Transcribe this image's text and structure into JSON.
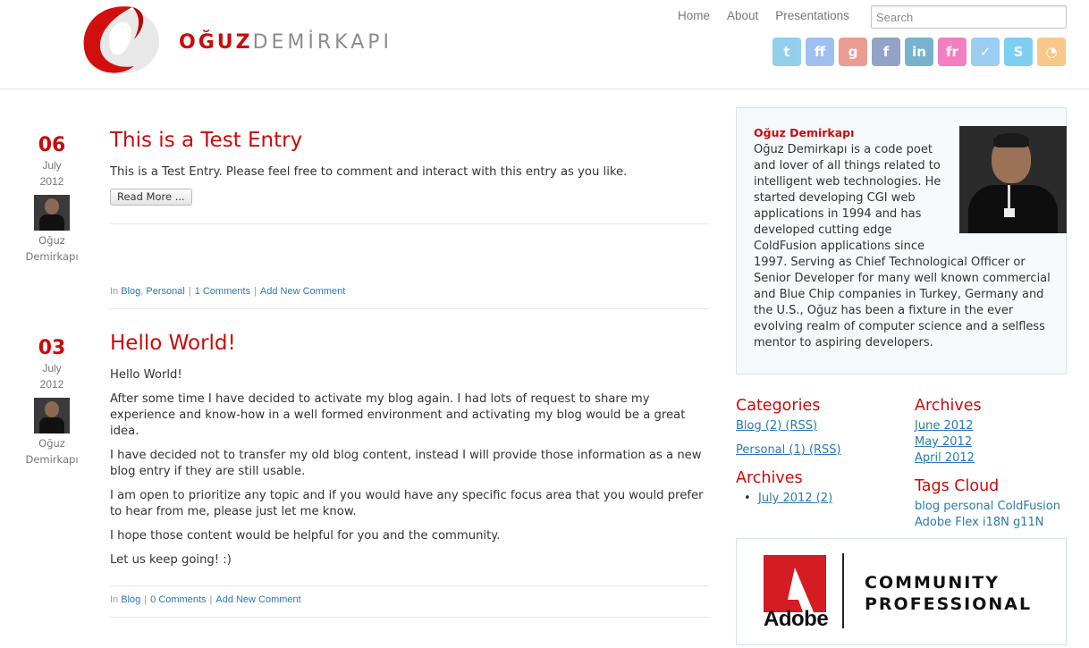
{
  "header": {
    "logo_first": "OĞUZ",
    "logo_last": "DEMİRKAPI",
    "nav": [
      "Home",
      "About",
      "Presentations"
    ],
    "search_placeholder": "Search",
    "social": [
      {
        "icon": "twitter-icon",
        "glyph": "t",
        "color": "#38a9e0"
      },
      {
        "icon": "friendfeed-icon",
        "glyph": "ff",
        "color": "#4f8ee6"
      },
      {
        "icon": "google-icon",
        "glyph": "g",
        "color": "#dd4b39"
      },
      {
        "icon": "facebook-icon",
        "glyph": "f",
        "color": "#3b5998"
      },
      {
        "icon": "linkedin-icon",
        "glyph": "in",
        "color": "#0c73a8"
      },
      {
        "icon": "friendster-icon",
        "glyph": "fr",
        "color": "#e8188d"
      },
      {
        "icon": "foursquare-icon",
        "glyph": "✓",
        "color": "#4aa7e4"
      },
      {
        "icon": "skype-icon",
        "glyph": "S",
        "color": "#13a9e6"
      },
      {
        "icon": "rss-icon",
        "glyph": "◔",
        "color": "#f39a2c"
      }
    ]
  },
  "posts": [
    {
      "day": "06",
      "month": "July",
      "year": "2012",
      "author_first": "Oğuz",
      "author_last": "Demirkapı",
      "title": "This is a Test Entry",
      "body": [
        "This is a Test Entry. Please feel free to comment and interact with this entry as you like."
      ],
      "read_more": "Read More ...",
      "meta_in": "In",
      "categories": [
        "Blog",
        "Personal"
      ],
      "comments": "1 Comments",
      "add_comment": "Add New Comment"
    },
    {
      "day": "03",
      "month": "July",
      "year": "2012",
      "author_first": "Oğuz",
      "author_last": "Demirkapı",
      "title": "Hello World!",
      "body": [
        "Hello World!",
        "After some time I have decided to activate my blog again. I had lots of request to share my experience and know-how in a well formed environment and activating my blog would be a great idea.",
        "I have decided not to transfer my old blog content, instead I will provide those information as a new blog entry if they are still usable.",
        "I am open to prioritize any topic and if you would have any specific focus area that you would prefer to hear from me, please just let me know.",
        "I hope those content would be helpful for you and the community.",
        "Let us keep going!  :)"
      ],
      "meta_in": "In",
      "categories": [
        "Blog"
      ],
      "comments": "0 Comments",
      "add_comment": "Add New Comment"
    }
  ],
  "sidebar": {
    "about_name": "Oğuz Demirkapı",
    "about_text": "Oğuz Demirkapı is a code poet and lover of all things related to intelligent web technologies. He started developing CGI web applications in 1994 and has developed cutting edge ColdFusion applications since 1997. Serving as Chief Technological Officer or Senior Developer for many well known commercial and Blue Chip companies in Turkey, Germany and the U.S., Oğuz has been a fixture in the ever evolving realm of computer science and a selfless mentor to aspiring developers.",
    "categories_heading": "Categories",
    "categories": [
      "Blog (2) (RSS)",
      "Personal (1) (RSS)"
    ],
    "archives_heading": "Archives",
    "archives_list": [
      "July 2012 (2)"
    ],
    "archives2_heading": "Archives",
    "archives2": [
      "June 2012",
      "May 2012",
      "April 2012"
    ],
    "tags_heading": "Tags Cloud",
    "tags": [
      "blog",
      "personal",
      "ColdFusion",
      "Adobe",
      "Flex",
      "i18N",
      "g11N"
    ],
    "badge_brand": "Adobe",
    "badge_line1": "COMMUNITY",
    "badge_line2": "PROFESSIONAL"
  }
}
